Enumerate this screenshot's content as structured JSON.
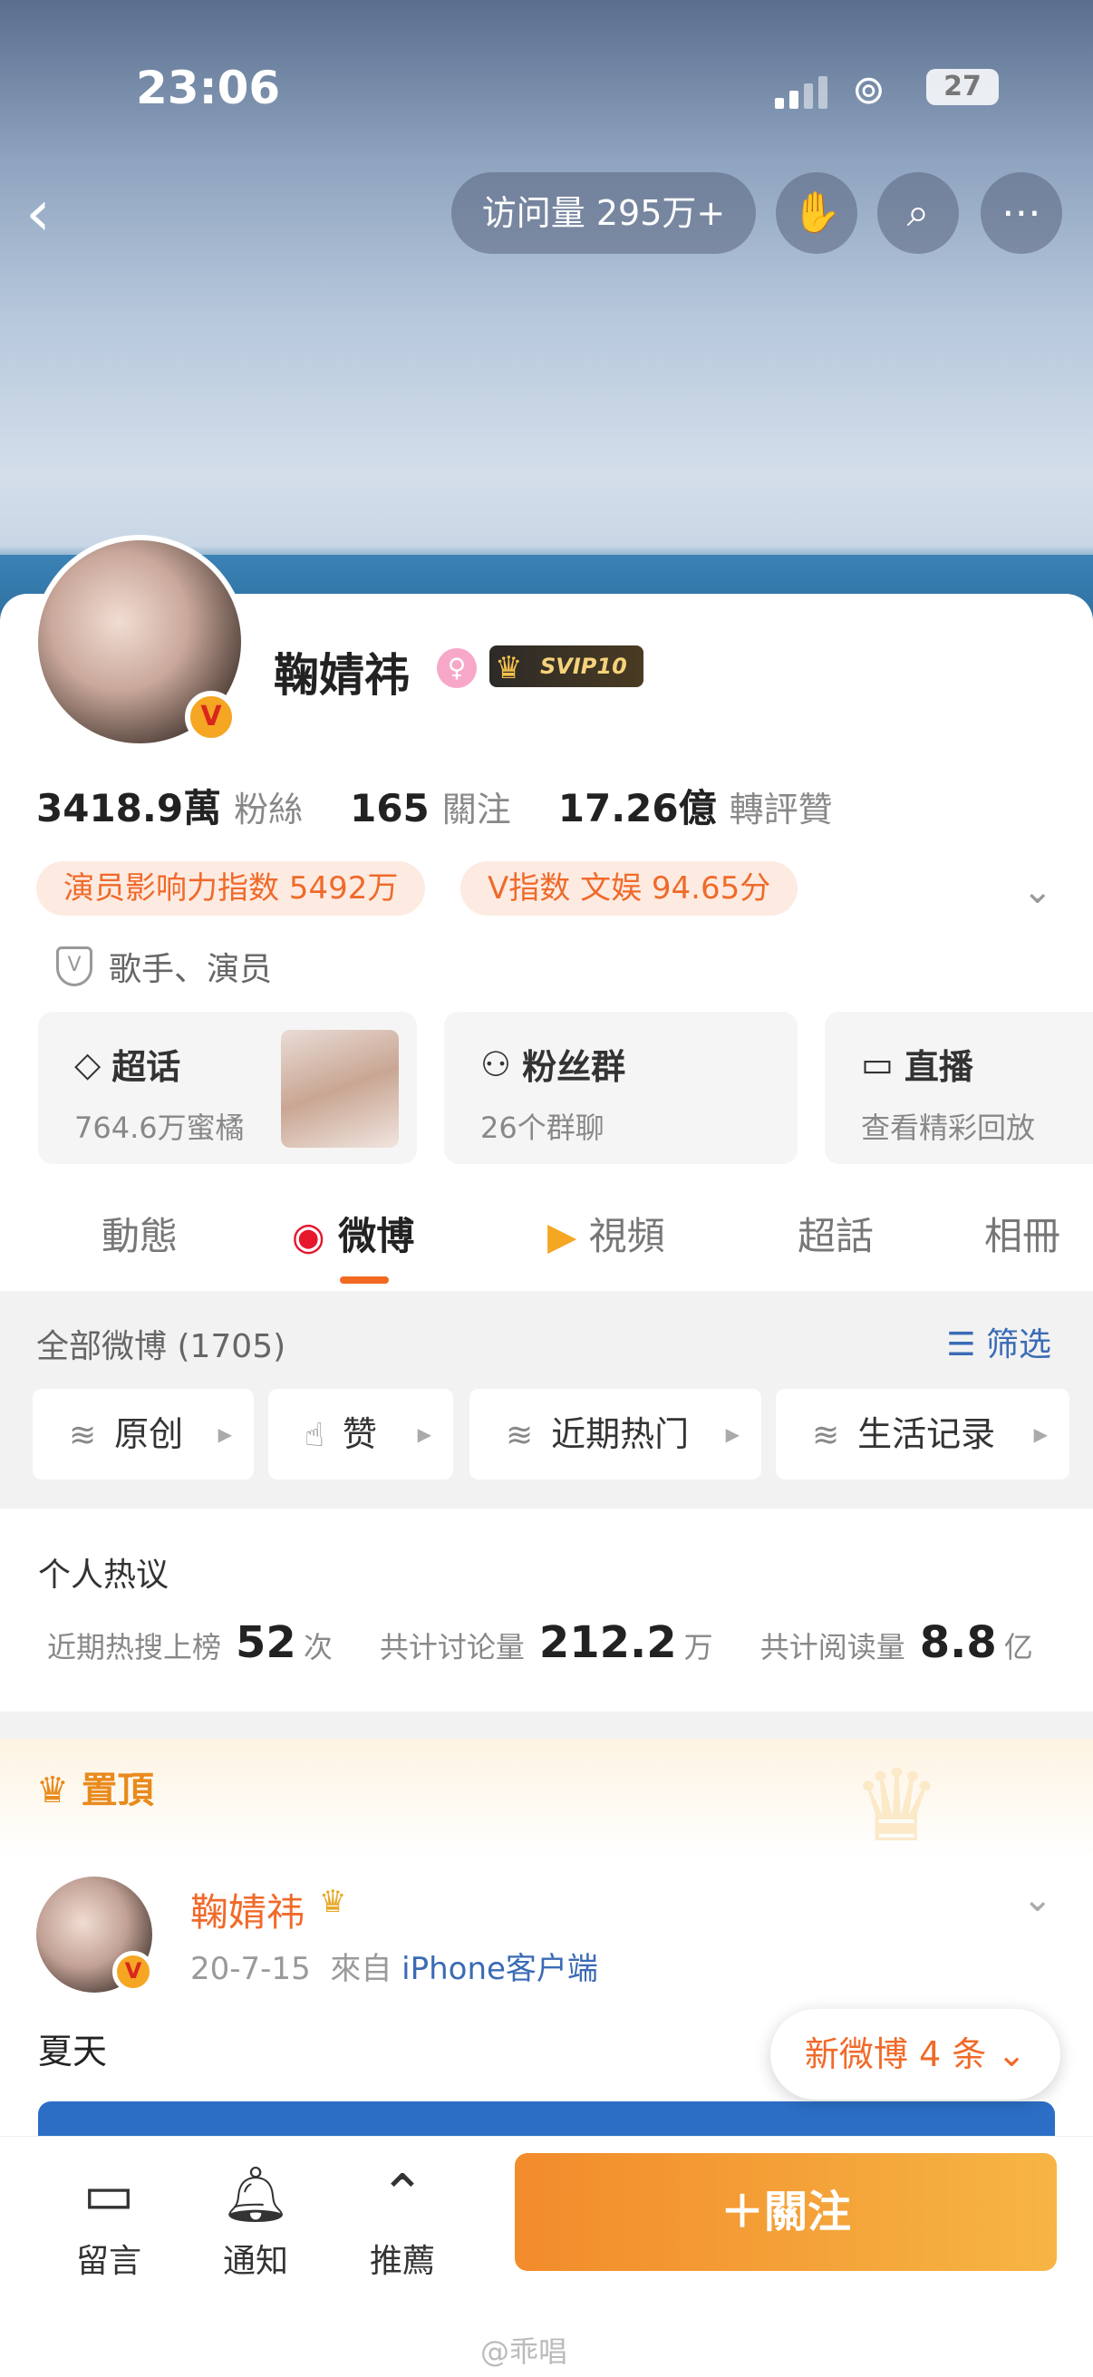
{
  "status": {
    "time": "23:06",
    "battery": "27"
  },
  "header": {
    "visits": "访问量 295万+"
  },
  "profile": {
    "name": "鞠婧祎",
    "svip": "SVIP10",
    "stats": [
      {
        "value": "3418.9萬",
        "label": "粉絲"
      },
      {
        "value": "165",
        "label": "關注"
      },
      {
        "value": "17.26億",
        "label": "轉評贊"
      }
    ],
    "tags": [
      "演员影响力指数 5492万",
      "V指数 文娱 94.65分"
    ],
    "roles": "歌手、演员",
    "boxes": [
      {
        "title": "超话",
        "sub": "764.6万蜜橘"
      },
      {
        "title": "粉丝群",
        "sub": "26个群聊"
      },
      {
        "title": "直播",
        "sub": "查看精彩回放"
      }
    ]
  },
  "tabs": [
    "動態",
    "微博",
    "視頻",
    "超話",
    "相冊"
  ],
  "feed": {
    "count": "全部微博 (1705)",
    "filter": "筛选",
    "chips": [
      "原创",
      "赞",
      "近期热门",
      "生活记录"
    ]
  },
  "hot": {
    "title": "个人热议",
    "items": [
      {
        "label": "近期热搜上榜",
        "value": "52",
        "unit": "次"
      },
      {
        "label": "共计讨论量",
        "value": "212.2",
        "unit": "万"
      },
      {
        "label": "共计阅读量",
        "value": "8.8",
        "unit": "亿"
      }
    ]
  },
  "pinned": {
    "label": "置頂",
    "author": "鞠婧祎",
    "date": "20-7-15",
    "from": "來自",
    "source": "iPhone客户端",
    "text": "夏天",
    "new_posts": "新微博 4 条"
  },
  "bottom": {
    "items": [
      "留言",
      "通知",
      "推薦"
    ],
    "follow": "＋關注",
    "watermark": "@乖唱"
  }
}
